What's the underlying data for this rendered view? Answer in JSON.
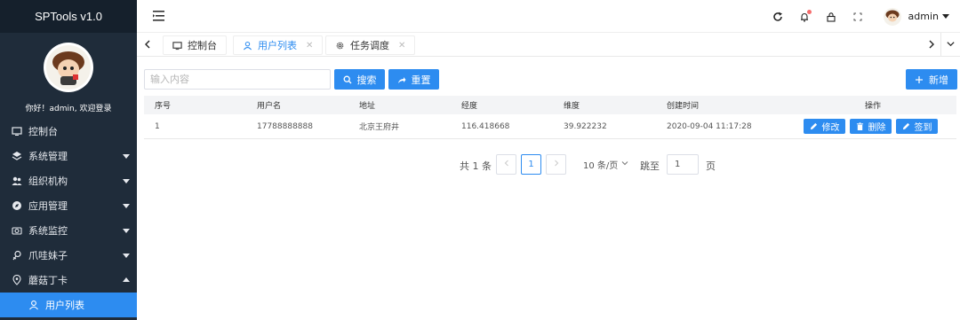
{
  "app": {
    "title": "SPTools v1.0",
    "welcome": "你好！admin, 欢迎登录"
  },
  "sidebar": {
    "items": [
      {
        "label": "控制台",
        "icon": "monitor-icon"
      },
      {
        "label": "系统管理",
        "icon": "layers-icon",
        "expandable": true
      },
      {
        "label": "组织机构",
        "icon": "users-icon",
        "expandable": true
      },
      {
        "label": "应用管理",
        "icon": "compass-icon",
        "expandable": true
      },
      {
        "label": "系统监控",
        "icon": "camera-icon",
        "expandable": true
      },
      {
        "label": "爪哇妹子",
        "icon": "female-icon",
        "expandable": true
      },
      {
        "label": "蘑菇丁卡",
        "icon": "location-icon",
        "expanded": true
      },
      {
        "label": "用户列表",
        "icon": "user-icon",
        "active": true
      }
    ]
  },
  "header": {
    "username": "admin",
    "notification_dot_color": "#f56c6c"
  },
  "tabs": [
    {
      "label": "控制台",
      "icon": "monitor-icon",
      "closable": false
    },
    {
      "label": "用户列表",
      "icon": "user-icon",
      "closable": true,
      "active": true
    },
    {
      "label": "任务调度",
      "icon": "gear-icon",
      "closable": true
    }
  ],
  "toolbar": {
    "search_placeholder": "输入内容",
    "search_label": "搜索",
    "reset_label": "重置",
    "add_label": "新增"
  },
  "table": {
    "headers": [
      "序号",
      "用户名",
      "地址",
      "经度",
      "维度",
      "创建时间",
      "操作"
    ],
    "rows": [
      {
        "index": "1",
        "username": "17788888888",
        "address": "北京王府井",
        "longitude": "116.418668",
        "latitude": "39.922232",
        "created": "2020-09-04 11:17:28"
      }
    ],
    "actions": {
      "edit": "修改",
      "delete": "删除",
      "sign": "签到"
    }
  },
  "pagination": {
    "total_text": "共 1 条",
    "current_page": "1",
    "page_size": "10 条/页",
    "goto_label": "跳至",
    "goto_value": "1",
    "page_suffix": "页"
  },
  "colors": {
    "primary": "#2d8cf0",
    "sidebar_bg": "#1f2c3a",
    "sidebar_title_bg": "#15202c"
  }
}
